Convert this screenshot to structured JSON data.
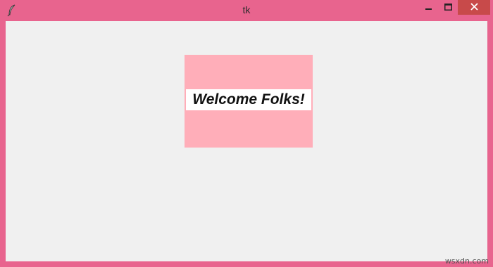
{
  "window": {
    "title": "tk",
    "icon": "feather-icon",
    "accent_color": "#e8648e",
    "close_color": "#c84a4a"
  },
  "controls": {
    "minimize_icon": "minimize-icon",
    "maximize_icon": "maximize-icon",
    "close_icon": "close-icon"
  },
  "content": {
    "frame_color": "#ffaeb9",
    "label_text": "Welcome Folks!",
    "label_bg": "#ffffff"
  },
  "watermark": {
    "text": "wsxdn.com"
  }
}
